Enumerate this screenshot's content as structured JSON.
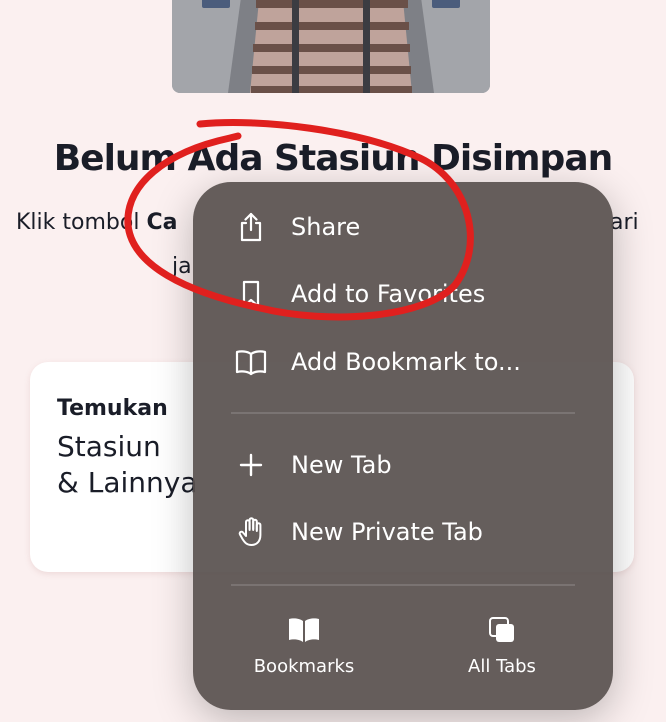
{
  "background": {
    "empty_state": {
      "title": "Belum Ada Stasiun Disimpan",
      "description_start": "Klik tombol ",
      "description_bold": "Ca",
      "description_end": "ari",
      "description_line2": "ja"
    },
    "discover_card": {
      "label": "Temukan",
      "heading_line1": "Stasiun",
      "heading_line2": "& Lainnya"
    }
  },
  "menu": {
    "items": [
      {
        "label": "Share",
        "icon": "share-icon"
      },
      {
        "label": "Add to Favorites",
        "icon": "bookmark-icon"
      },
      {
        "label": "Add Bookmark to...",
        "icon": "book-open-icon"
      },
      {
        "label": "New Tab",
        "icon": "plus-icon"
      },
      {
        "label": "New Private Tab",
        "icon": "hand-icon"
      }
    ],
    "footer": [
      {
        "label": "Bookmarks",
        "icon": "bookmarks-icon"
      },
      {
        "label": "All Tabs",
        "icon": "tabs-icon"
      }
    ]
  },
  "colors": {
    "page_background": "#fbf0f0",
    "menu_background": "#58504e",
    "annotation_stroke": "#e0201e",
    "text_dark": "#1a1d28"
  }
}
